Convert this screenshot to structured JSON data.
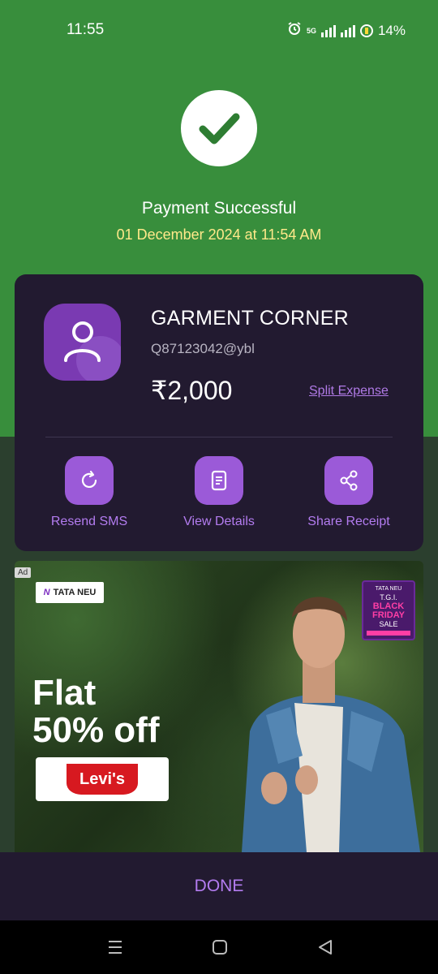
{
  "status_bar": {
    "time": "11:55",
    "network": "5G",
    "battery": "14%"
  },
  "payment": {
    "title": "Payment Successful",
    "datetime": "01 December 2024 at 11:54 AM"
  },
  "merchant": {
    "name": "GARMENT CORNER",
    "upi_id": "Q87123042@ybl",
    "amount": "₹2,000",
    "split_label": "Split Expense"
  },
  "actions": [
    {
      "label": "Resend SMS",
      "icon": "refresh-icon"
    },
    {
      "label": "View Details",
      "icon": "document-icon"
    },
    {
      "label": "Share Receipt",
      "icon": "share-icon"
    }
  ],
  "ad": {
    "tag": "Ad",
    "brand": "TATA NEU",
    "headline_line1": "Flat",
    "headline_line2": "50% off",
    "logo": "Levi's",
    "badge_brand": "TATA NEU",
    "badge_line1": "T.G.I.",
    "badge_line2": "BLACK",
    "badge_line3": "FRIDAY",
    "badge_line4": "SALE"
  },
  "footer": {
    "done_label": "DONE"
  },
  "colors": {
    "success_green": "#388e3c",
    "card_bg": "#221a30",
    "accent_purple": "#9b5ad8",
    "date_yellow": "#ffe98a"
  }
}
